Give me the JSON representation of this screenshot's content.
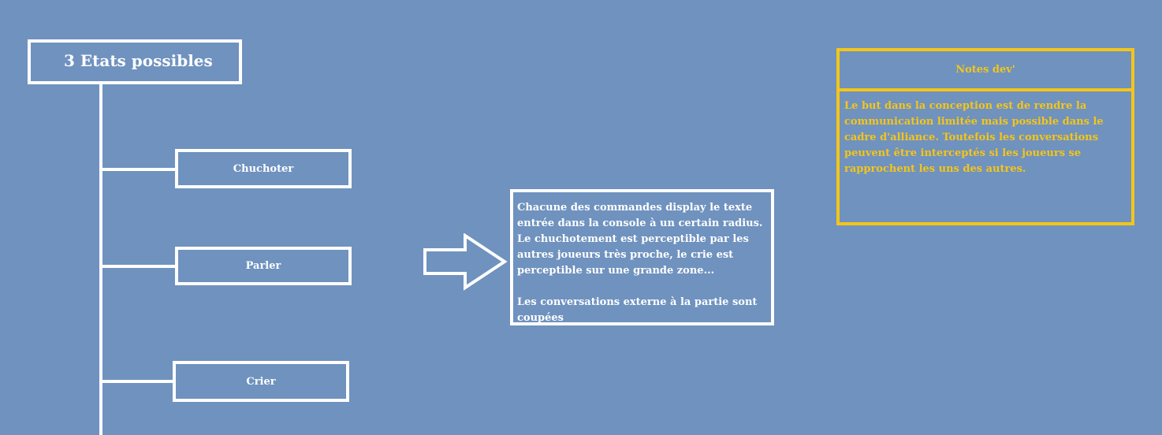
{
  "diagram": {
    "title": "3 Etats possibles",
    "states": [
      {
        "label": "Chuchoter"
      },
      {
        "label": "Parler"
      },
      {
        "label": "Crier"
      }
    ]
  },
  "description": {
    "line1": "Chacune des commandes display le texte entrée dans la console à un certain  radius.",
    "line2": "Le chuchotement est perceptible par les autres joueurs très proche, le crie est perceptible sur une grande zone...",
    "line3": "Les conversations externe à la partie sont coupées"
  },
  "notes": {
    "title": "Notes dev'",
    "body": "Le but dans la conception est de rendre la communication limitée mais possible dans le cadre d'alliance. Toutefois les conversations peuvent être interceptés si les joueurs se rapprochent les uns des autres."
  },
  "colors": {
    "background": "#6f92bf",
    "shape_stroke": "#ffffff",
    "notes_accent": "#f5c518"
  }
}
